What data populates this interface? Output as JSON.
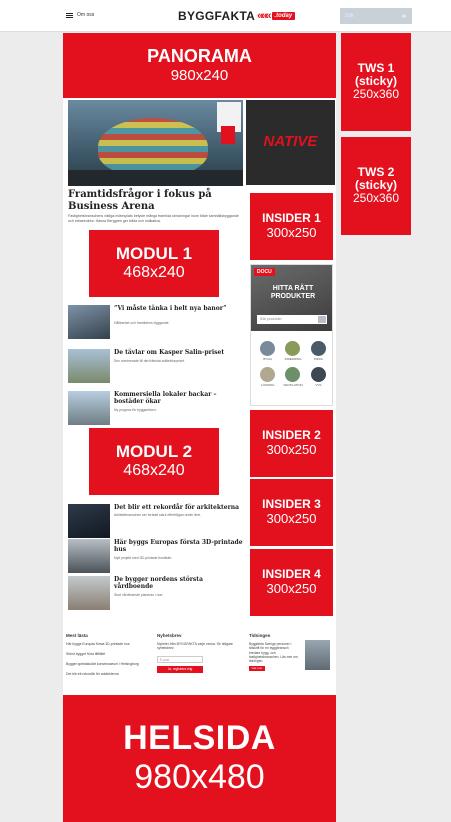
{
  "header": {
    "menu_label": "Om oss",
    "logo_text": "BYGGFAKTA",
    "logo_chevrons": "«««",
    "logo_today": ".today",
    "search_placeholder": "Sök",
    "search_go": "⊳"
  },
  "ads": {
    "panorama": {
      "name": "PANORAMA",
      "size": "980x240"
    },
    "tws1": {
      "name": "TWS 1 (sticky)",
      "size": "250x360"
    },
    "tws2": {
      "name": "TWS 2 (sticky)",
      "size": "250x360"
    },
    "native": {
      "name": "NATIVE"
    },
    "modul1": {
      "name": "MODUL 1",
      "size": "468x240"
    },
    "modul2": {
      "name": "MODUL 2",
      "size": "468x240"
    },
    "insider1": {
      "name": "INSIDER 1",
      "size": "300x250"
    },
    "insider2": {
      "name": "INSIDER 2",
      "size": "300x250"
    },
    "insider3": {
      "name": "INSIDER 3",
      "size": "300x250"
    },
    "insider4": {
      "name": "INSIDER 4",
      "size": "300x250"
    },
    "helsida": {
      "name": "HELSIDA",
      "size": "980x480"
    }
  },
  "hero": {
    "title": "Framtidsfrågor i fokus på Business Arena",
    "desc": "Fastighetsbranschens viktiga mötesplats belyste många framtida utmaningar inom både samhällsbyggande och infrastruktur. Hanna Berggren ger båda och indikativa."
  },
  "docu": {
    "badge": "DOCU",
    "title": "HITTA RÄTT PRODUKTER",
    "search_placeholder": "Sök produkter",
    "categories": [
      "BYGG",
      "INREDNING",
      "INFRA",
      "LÖSNING",
      "VENTILATION",
      "VVS"
    ]
  },
  "articles": [
    {
      "title": "”Vi måste tänka i helt nya banor”",
      "desc": "Hållbarhet och framtidens byggande."
    },
    {
      "title": "De tävlar om Kasper Salin-priset",
      "desc": "Sex nominerade till det främsta arkitekturpriset."
    },
    {
      "title": "Kommersiella lokaler backar – bostäder ökar",
      "desc": "Ny prognos för byggsektorn."
    },
    {
      "title": "Det blir ett rekordår för arkitekterna",
      "desc": "Arkitektbranschen ser fortsatt stark efterfrågan under året."
    },
    {
      "title": "Här byggs Europas första 3D-printade hus",
      "desc": "Nytt projekt med 3D-printade bostäder."
    },
    {
      "title": "De bygger nordens största vårdboende",
      "desc": "Stort vårdboende planeras i norr."
    }
  ],
  "footer": {
    "most_read_heading": "Mest lästa",
    "most_read": [
      "Här byggs Europas första 3D-printade hus",
      "Störst bygget förra tillfället",
      "Bygger spektakulärt konstmuseum i Helsingborg",
      "Det blir ett rekordår för arkitekterna"
    ],
    "newsletter_heading": "Nyhetsbrev",
    "newsletter_text": "Nyheter från BYGGFAKTA varje vecka. Se tidigare nyhetsbrev.",
    "newsletter_input": "E-post",
    "newsletter_button": "Ja, registrera mig",
    "tidningen_heading": "Tidningen",
    "tidningen_text": "Byggfakta Sverige personer i tidskrift för en byggbransch bredare bygg- och fastighetsbranschen. Läs mer om tidningen.",
    "tidningen_button": "Läs mer"
  },
  "colors": {
    "accent": "#e3101e",
    "native_bg": "#2b2b2b",
    "page_bg": "#ececec"
  }
}
